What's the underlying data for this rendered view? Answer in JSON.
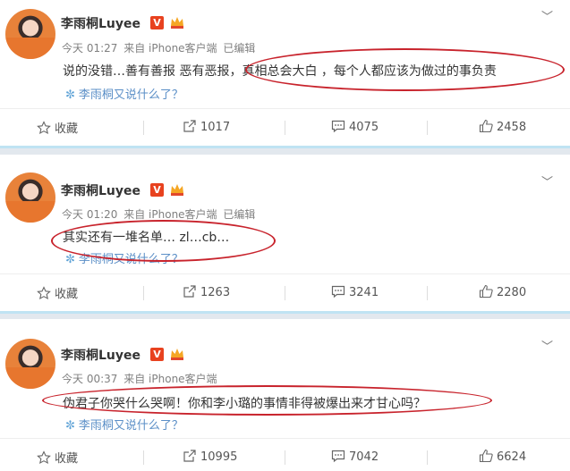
{
  "posts": [
    {
      "author": "李雨桐Luyee",
      "verified": "V",
      "time": "今天 01:27",
      "client": "来自 iPhone客户端",
      "edited": "已编辑",
      "text_a": "说的没错…善有善报 恶有恶报，",
      "text_b": "真相总会大白 ，每个人都应该为做过的事负责",
      "source": "李雨桐又说什么了？",
      "fav": "收藏",
      "repost": "1017",
      "comment": "4075",
      "like": "2458"
    },
    {
      "author": "李雨桐Luyee",
      "verified": "V",
      "time": "今天 01:20",
      "client": "来自 iPhone客户端",
      "edited": "已编辑",
      "text_a": "其实还有一堆名单… zl…cb…",
      "source": "李雨桐又说什么了？",
      "fav": "收藏",
      "repost": "1263",
      "comment": "3241",
      "like": "2280"
    },
    {
      "author": "李雨桐Luyee",
      "verified": "V",
      "time": "今天 00:37",
      "client": "来自 iPhone客户端",
      "text_a": "伪君子你哭什么哭啊！你和李小璐的事情非得被爆出来才甘心吗？",
      "source": "李雨桐又说什么了？",
      "fav": "收藏",
      "repost": "10995",
      "comment": "7042",
      "like": "6624"
    }
  ],
  "icons": {
    "chevron": "chevron-down-icon",
    "favorite": "star-icon",
    "repost": "share-icon",
    "comment": "comment-icon",
    "like": "thumbs-up-icon",
    "source": "asterisk-icon"
  },
  "colors": {
    "annotation_red": "#c8232c",
    "link_blue": "#5b8fc7",
    "verified_orange": "#e8421f"
  }
}
